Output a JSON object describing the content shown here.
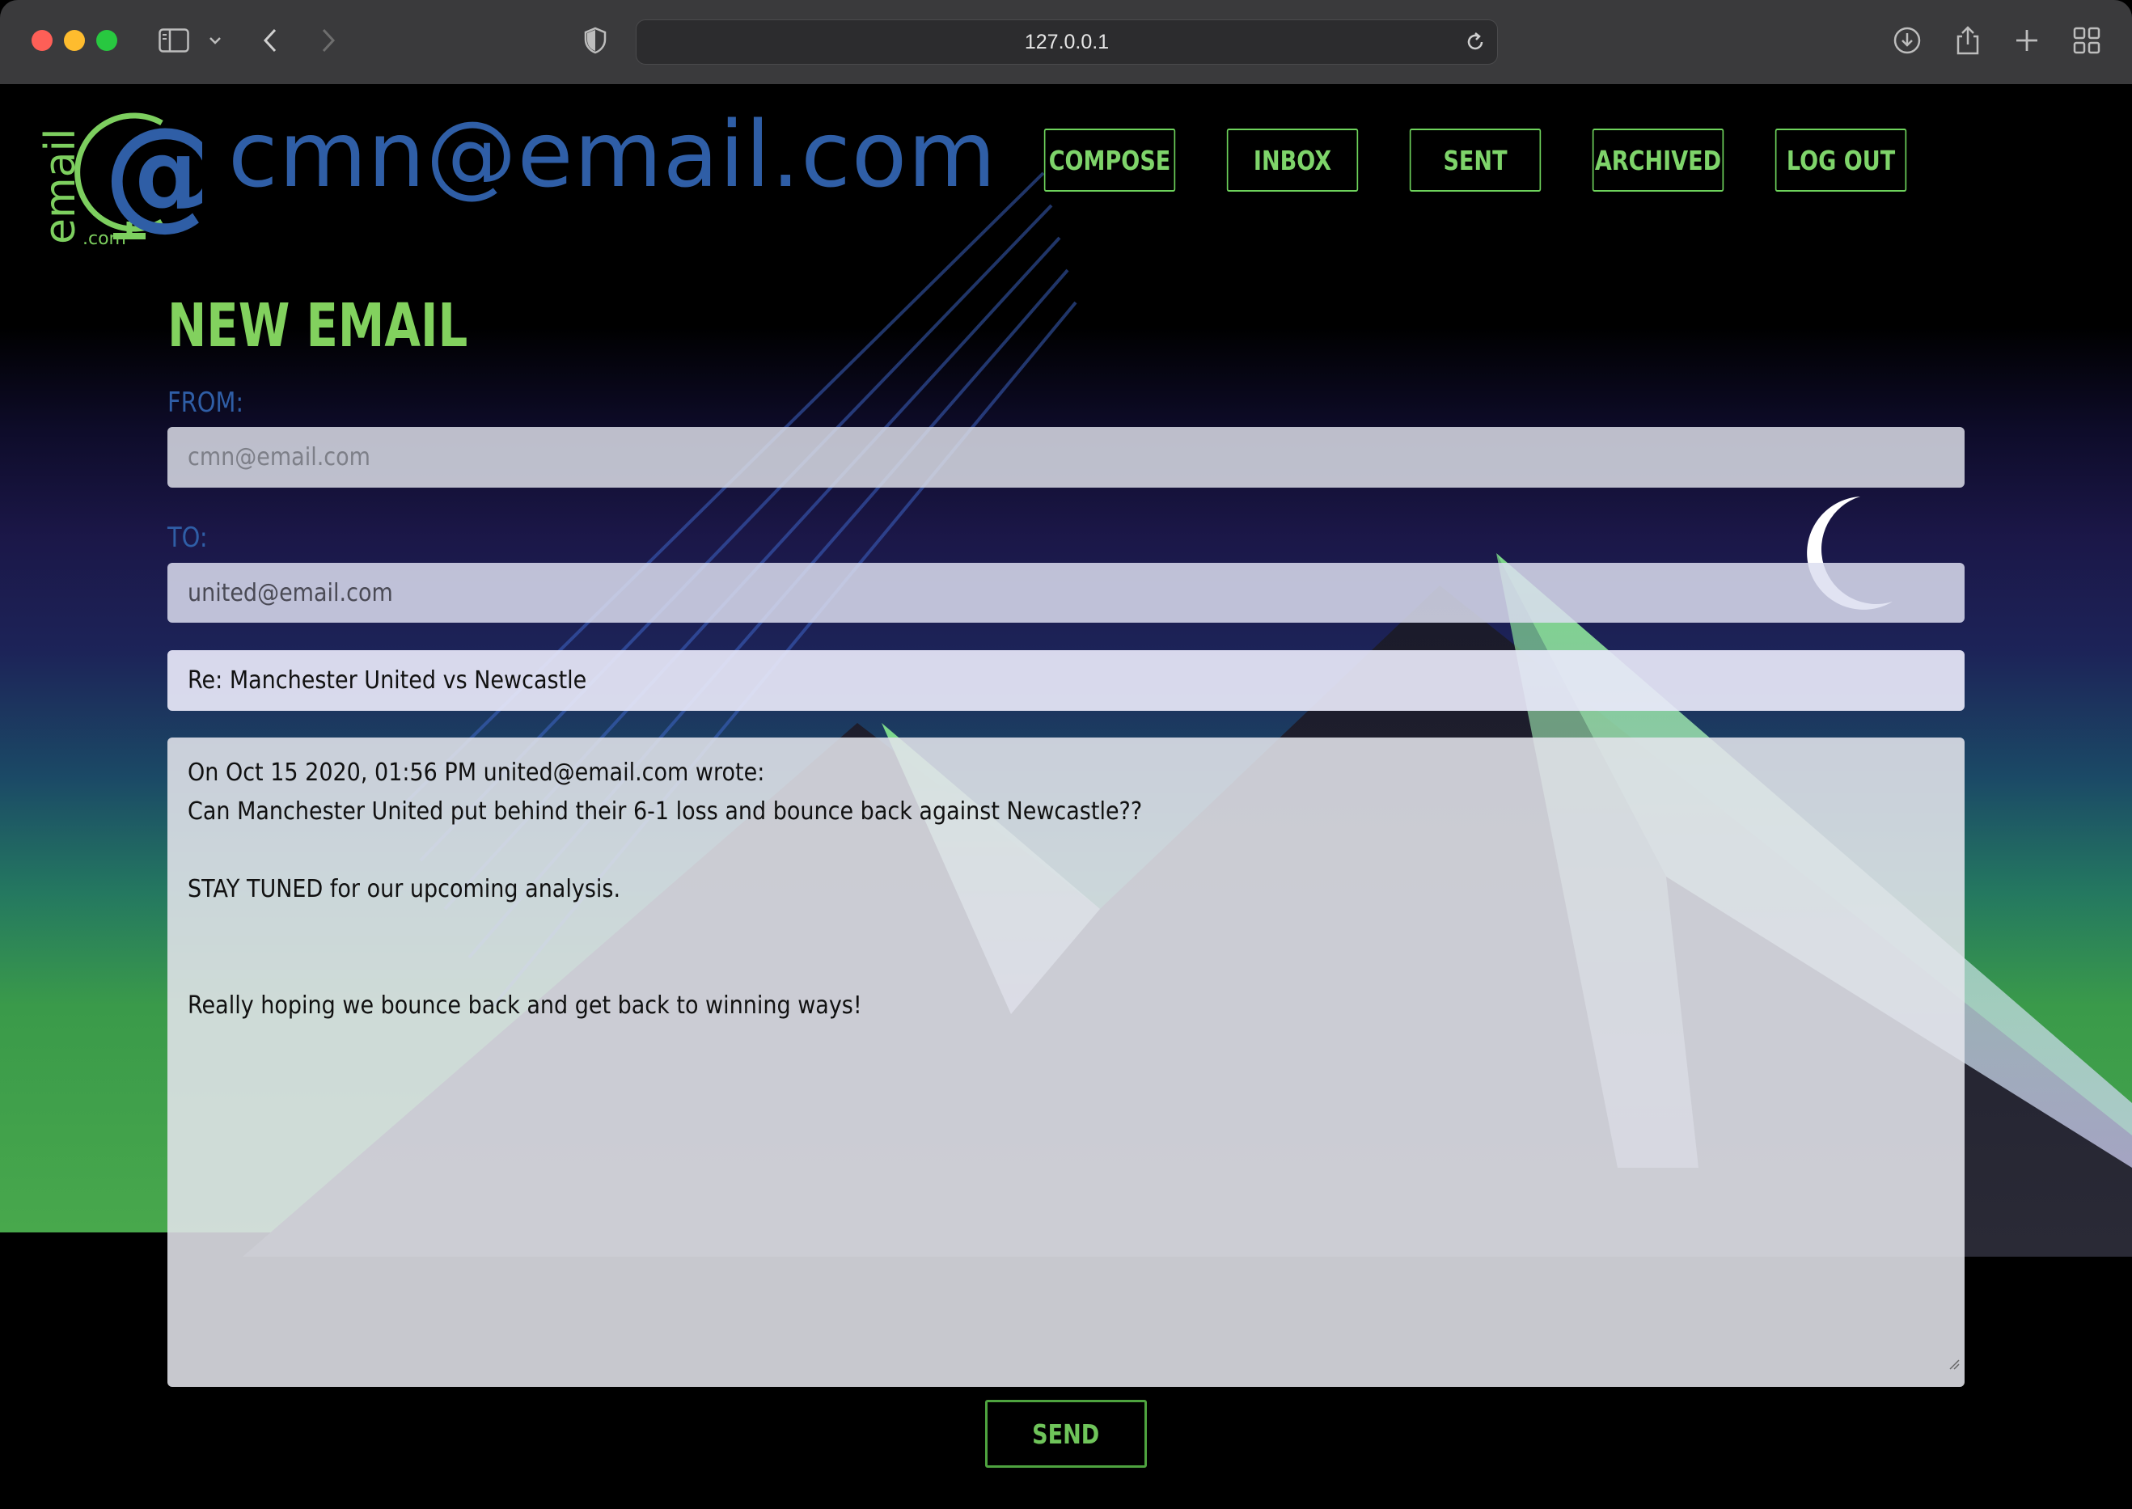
{
  "browser": {
    "url": "127.0.0.1"
  },
  "site": {
    "logo_word": "email",
    "logo_suffix": ".com",
    "user_email": "cmn@email.com"
  },
  "nav": {
    "items": [
      {
        "label": "COMPOSE"
      },
      {
        "label": "INBOX"
      },
      {
        "label": "SENT"
      },
      {
        "label": "ARCHIVED"
      },
      {
        "label": "LOG OUT"
      }
    ]
  },
  "compose": {
    "title": "NEW EMAIL",
    "from_label": "FROM:",
    "from_value": "cmn@email.com",
    "to_label": "TO:",
    "to_value": "united@email.com",
    "subject_value": "Re: Manchester United vs Newcastle",
    "body_lines": [
      "On Oct 15 2020, 01:56 PM united@email.com wrote:",
      "Can Manchester United put behind their 6-1 loss and bounce back against Newcastle??",
      "",
      "STAY TUNED for our upcoming analysis.",
      "",
      "",
      "Really hoping we bounce back and get back to winning ways!"
    ],
    "send_label": "SEND"
  },
  "colors": {
    "accent_green": "#7ed46a",
    "brand_blue": "#2f5ea6"
  }
}
